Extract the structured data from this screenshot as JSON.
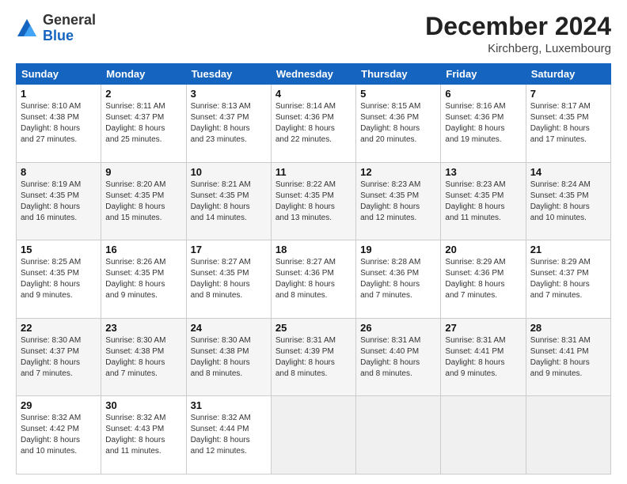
{
  "header": {
    "logo_general": "General",
    "logo_blue": "Blue",
    "month_title": "December 2024",
    "location": "Kirchberg, Luxembourg"
  },
  "days_of_week": [
    "Sunday",
    "Monday",
    "Tuesday",
    "Wednesday",
    "Thursday",
    "Friday",
    "Saturday"
  ],
  "weeks": [
    [
      {
        "day": "1",
        "info": "Sunrise: 8:10 AM\nSunset: 4:38 PM\nDaylight: 8 hours\nand 27 minutes."
      },
      {
        "day": "2",
        "info": "Sunrise: 8:11 AM\nSunset: 4:37 PM\nDaylight: 8 hours\nand 25 minutes."
      },
      {
        "day": "3",
        "info": "Sunrise: 8:13 AM\nSunset: 4:37 PM\nDaylight: 8 hours\nand 23 minutes."
      },
      {
        "day": "4",
        "info": "Sunrise: 8:14 AM\nSunset: 4:36 PM\nDaylight: 8 hours\nand 22 minutes."
      },
      {
        "day": "5",
        "info": "Sunrise: 8:15 AM\nSunset: 4:36 PM\nDaylight: 8 hours\nand 20 minutes."
      },
      {
        "day": "6",
        "info": "Sunrise: 8:16 AM\nSunset: 4:36 PM\nDaylight: 8 hours\nand 19 minutes."
      },
      {
        "day": "7",
        "info": "Sunrise: 8:17 AM\nSunset: 4:35 PM\nDaylight: 8 hours\nand 17 minutes."
      }
    ],
    [
      {
        "day": "8",
        "info": "Sunrise: 8:19 AM\nSunset: 4:35 PM\nDaylight: 8 hours\nand 16 minutes."
      },
      {
        "day": "9",
        "info": "Sunrise: 8:20 AM\nSunset: 4:35 PM\nDaylight: 8 hours\nand 15 minutes."
      },
      {
        "day": "10",
        "info": "Sunrise: 8:21 AM\nSunset: 4:35 PM\nDaylight: 8 hours\nand 14 minutes."
      },
      {
        "day": "11",
        "info": "Sunrise: 8:22 AM\nSunset: 4:35 PM\nDaylight: 8 hours\nand 13 minutes."
      },
      {
        "day": "12",
        "info": "Sunrise: 8:23 AM\nSunset: 4:35 PM\nDaylight: 8 hours\nand 12 minutes."
      },
      {
        "day": "13",
        "info": "Sunrise: 8:23 AM\nSunset: 4:35 PM\nDaylight: 8 hours\nand 11 minutes."
      },
      {
        "day": "14",
        "info": "Sunrise: 8:24 AM\nSunset: 4:35 PM\nDaylight: 8 hours\nand 10 minutes."
      }
    ],
    [
      {
        "day": "15",
        "info": "Sunrise: 8:25 AM\nSunset: 4:35 PM\nDaylight: 8 hours\nand 9 minutes."
      },
      {
        "day": "16",
        "info": "Sunrise: 8:26 AM\nSunset: 4:35 PM\nDaylight: 8 hours\nand 9 minutes."
      },
      {
        "day": "17",
        "info": "Sunrise: 8:27 AM\nSunset: 4:35 PM\nDaylight: 8 hours\nand 8 minutes."
      },
      {
        "day": "18",
        "info": "Sunrise: 8:27 AM\nSunset: 4:36 PM\nDaylight: 8 hours\nand 8 minutes."
      },
      {
        "day": "19",
        "info": "Sunrise: 8:28 AM\nSunset: 4:36 PM\nDaylight: 8 hours\nand 7 minutes."
      },
      {
        "day": "20",
        "info": "Sunrise: 8:29 AM\nSunset: 4:36 PM\nDaylight: 8 hours\nand 7 minutes."
      },
      {
        "day": "21",
        "info": "Sunrise: 8:29 AM\nSunset: 4:37 PM\nDaylight: 8 hours\nand 7 minutes."
      }
    ],
    [
      {
        "day": "22",
        "info": "Sunrise: 8:30 AM\nSunset: 4:37 PM\nDaylight: 8 hours\nand 7 minutes."
      },
      {
        "day": "23",
        "info": "Sunrise: 8:30 AM\nSunset: 4:38 PM\nDaylight: 8 hours\nand 7 minutes."
      },
      {
        "day": "24",
        "info": "Sunrise: 8:30 AM\nSunset: 4:38 PM\nDaylight: 8 hours\nand 8 minutes."
      },
      {
        "day": "25",
        "info": "Sunrise: 8:31 AM\nSunset: 4:39 PM\nDaylight: 8 hours\nand 8 minutes."
      },
      {
        "day": "26",
        "info": "Sunrise: 8:31 AM\nSunset: 4:40 PM\nDaylight: 8 hours\nand 8 minutes."
      },
      {
        "day": "27",
        "info": "Sunrise: 8:31 AM\nSunset: 4:41 PM\nDaylight: 8 hours\nand 9 minutes."
      },
      {
        "day": "28",
        "info": "Sunrise: 8:31 AM\nSunset: 4:41 PM\nDaylight: 8 hours\nand 9 minutes."
      }
    ],
    [
      {
        "day": "29",
        "info": "Sunrise: 8:32 AM\nSunset: 4:42 PM\nDaylight: 8 hours\nand 10 minutes."
      },
      {
        "day": "30",
        "info": "Sunrise: 8:32 AM\nSunset: 4:43 PM\nDaylight: 8 hours\nand 11 minutes."
      },
      {
        "day": "31",
        "info": "Sunrise: 8:32 AM\nSunset: 4:44 PM\nDaylight: 8 hours\nand 12 minutes."
      },
      null,
      null,
      null,
      null
    ]
  ]
}
